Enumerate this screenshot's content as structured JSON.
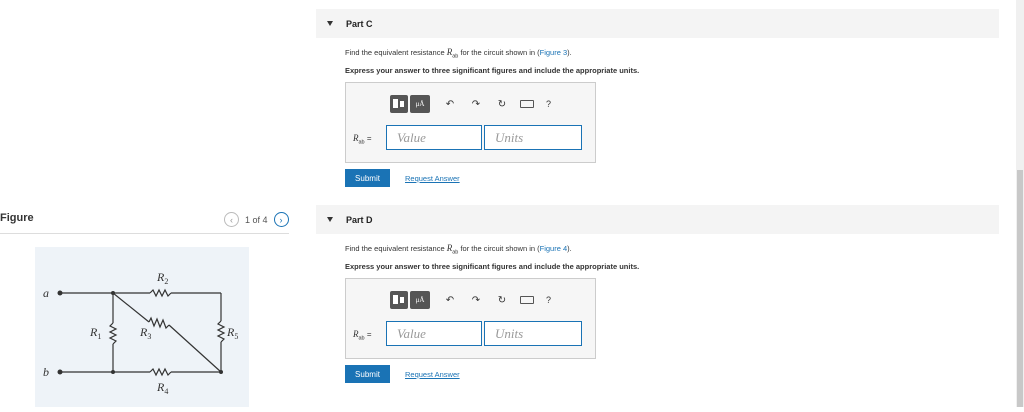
{
  "figure": {
    "label": "Figure",
    "pager_text": "1 of 4",
    "circuit": {
      "node_a": "a",
      "node_b": "b",
      "r1": "R",
      "r1_sub": "1",
      "r2": "R",
      "r2_sub": "2",
      "r3": "R",
      "r3_sub": "3",
      "r4": "R",
      "r4_sub": "4",
      "r5": "R",
      "r5_sub": "5"
    }
  },
  "parts": [
    {
      "title": "Part C",
      "question_pre": "Find the equivalent resistance ",
      "question_sym": "R",
      "question_sub": "ab",
      "question_mid": " for the circuit shown in (",
      "question_link": "Figure 3",
      "question_post": ").",
      "instruction": "Express your answer to three significant figures and include the appropriate units.",
      "toolbar_mu": "μÅ",
      "answer_label_sym": "R",
      "answer_label_sub": "ab",
      "answer_label_eq": " =",
      "value_placeholder": "Value",
      "units_placeholder": "Units",
      "submit_label": "Submit",
      "request_label": "Request Answer"
    },
    {
      "title": "Part D",
      "question_pre": "Find the equivalent resistance ",
      "question_sym": "R",
      "question_sub": "ab",
      "question_mid": " for the circuit shown in (",
      "question_link": "Figure 4",
      "question_post": ").",
      "instruction": "Express your answer to three significant figures and include the appropriate units.",
      "toolbar_mu": "μÅ",
      "answer_label_sym": "R",
      "answer_label_sub": "ab",
      "answer_label_eq": " =",
      "value_placeholder": "Value",
      "units_placeholder": "Units",
      "submit_label": "Submit",
      "request_label": "Request Answer"
    }
  ],
  "icons": {
    "undo": "undo-icon",
    "redo": "redo-icon",
    "reset": "reset-icon",
    "keyboard": "keyboard-icon",
    "help": "help-icon"
  }
}
